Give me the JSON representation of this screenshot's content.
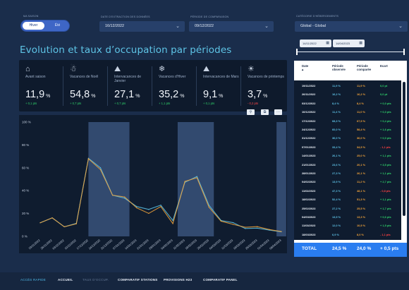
{
  "filters": {
    "season_label": "Ma saison",
    "season_options": [
      "Hiver",
      "Été"
    ],
    "date_label": "Date d'extraction des données",
    "date_value": "16/12/2022",
    "compare_label": "Période de comparaison",
    "compare_value": "09/12/2022",
    "category_label": "Catégorie d'hébergements",
    "category_value": "Global - Global"
  },
  "title": "Evolution et taux d’occupation par périodes",
  "date_range": {
    "start": "14/11/2022",
    "end": "14/04/2023"
  },
  "kpis": [
    {
      "icon": "⌂",
      "icon_name": "house-icon",
      "name": "Avant saison",
      "value": "11,9",
      "unit": "%",
      "delta": "+ 0,1 pts",
      "negative": false
    },
    {
      "icon": "☃",
      "icon_name": "christmas-tree-icon",
      "name": "Vacances de Noël",
      "value": "54,8",
      "unit": "%",
      "delta": "+ 0,7 pts",
      "negative": false
    },
    {
      "icon": "⛰",
      "icon_name": "mountain-icon",
      "name": "Intervacances de Janvier",
      "value": "27,1",
      "unit": "%",
      "delta": "+ 0,7 pts",
      "negative": false
    },
    {
      "icon": "❄",
      "icon_name": "snowflake-icon",
      "name": "Vacances d'Hiver",
      "value": "35,2",
      "unit": "%",
      "delta": "+ 1,1 pts",
      "negative": false
    },
    {
      "icon": "⛰",
      "icon_name": "mountain-icon",
      "name": "Intervacances de Mars",
      "value": "9,1",
      "unit": "%",
      "delta": "+ 0,1 pts",
      "negative": false
    },
    {
      "icon": "☀",
      "icon_name": "sun-icon",
      "name": "Vacances de printemps",
      "value": "3,7",
      "unit": "%",
      "delta": "- 0,2 pts",
      "negative": true
    }
  ],
  "table": {
    "headers": {
      "date": "Date",
      "observed": "Période observée",
      "compared": "Période comparée",
      "ecart": "Ecart"
    },
    "rows": [
      {
        "date": "19/11/2022",
        "obs": "11,9 %",
        "cmp": "11,9 %",
        "ecart": "0,0 pt",
        "neg": false
      },
      {
        "date": "26/11/2022",
        "obs": "16,2 %",
        "cmp": "16,2 %",
        "ecart": "0,0 pt",
        "neg": false
      },
      {
        "date": "03/12/2022",
        "obs": "8,4 %",
        "cmp": "8,4 %",
        "ecart": "+ 0,0 pts",
        "neg": false
      },
      {
        "date": "10/12/2022",
        "obs": "11,4 %",
        "cmp": "11,0 %",
        "ecart": "+ 0,3 pts",
        "neg": false
      },
      {
        "date": "17/12/2022",
        "obs": "68,3 %",
        "cmp": "67,9 %",
        "ecart": "+ 0,4 pts",
        "neg": false
      },
      {
        "date": "24/12/2022",
        "obs": "60,0 %",
        "cmp": "58,4 %",
        "ecart": "+ 1,6 pts",
        "neg": false
      },
      {
        "date": "31/12/2022",
        "obs": "36,0 %",
        "cmp": "36,0 %",
        "ecart": "+ 0,0 pts",
        "neg": false
      },
      {
        "date": "07/01/2023",
        "obs": "33,4 %",
        "cmp": "34,5 %",
        "ecart": "- 1,1 pts",
        "neg": true
      },
      {
        "date": "14/01/2023",
        "obs": "26,1 %",
        "cmp": "25,0 %",
        "ecart": "+ 1,1 pts",
        "neg": false
      },
      {
        "date": "21/01/2023",
        "obs": "23,6 %",
        "cmp": "20,1 %",
        "ecart": "+ 3,5 pts",
        "neg": false
      },
      {
        "date": "28/01/2023",
        "obs": "27,3 %",
        "cmp": "26,1 %",
        "ecart": "+ 1,1 pts",
        "neg": false
      },
      {
        "date": "04/02/2023",
        "obs": "13,9 %",
        "cmp": "11,2 %",
        "ecart": "+ 2,7 pts",
        "neg": false
      },
      {
        "date": "11/02/2023",
        "obs": "47,3 %",
        "cmp": "48,1 %",
        "ecart": "- 0,8 pts",
        "neg": true
      },
      {
        "date": "18/02/2023",
        "obs": "52,4 %",
        "cmp": "51,3 %",
        "ecart": "+ 1,1 pts",
        "neg": false
      },
      {
        "date": "25/02/2023",
        "obs": "27,2 %",
        "cmp": "25,5 %",
        "ecart": "+ 1,7 pts",
        "neg": false
      },
      {
        "date": "04/03/2023",
        "obs": "13,9 %",
        "cmp": "13,3 %",
        "ecart": "+ 0,6 pts",
        "neg": false
      },
      {
        "date": "11/03/2023",
        "obs": "12,0 %",
        "cmp": "10,5 %",
        "ecart": "+ 1,5 pts",
        "neg": false
      },
      {
        "date": "18/03/2023",
        "obs": "6,9 %",
        "cmp": "8,0 %",
        "ecart": "- 1,1 pts",
        "neg": true
      }
    ],
    "total": {
      "label": "TOTAL",
      "obs": "24,5 %",
      "cmp": "24,0 %",
      "ecart": "+ 0,5 pts"
    }
  },
  "chart_data": {
    "type": "line",
    "x": [
      "19/11/2022",
      "26/11/2022",
      "03/12/2022",
      "10/12/2022",
      "17/12/2022",
      "24/12/2022",
      "31/12/2022",
      "07/01/2023",
      "14/01/2023",
      "21/01/2023",
      "28/01/2023",
      "04/02/2023",
      "11/02/2023",
      "18/02/2023",
      "25/02/2023",
      "04/03/2023",
      "11/03/2023",
      "18/03/2023",
      "25/03/2023",
      "01/04/2023",
      "08/04/2023"
    ],
    "series": [
      {
        "color": "#5ec4e6",
        "values": [
          11.9,
          16.2,
          8.4,
          11.4,
          68.3,
          60.0,
          36.0,
          33.4,
          26.1,
          23.6,
          27.3,
          13.9,
          47.3,
          52.4,
          27.2,
          13.9,
          12.0,
          6.9,
          7.2,
          5.5,
          4.0
        ]
      },
      {
        "color": "#f2a33a",
        "values": [
          11.9,
          16.2,
          8.4,
          11.0,
          67.9,
          58.4,
          36.0,
          34.5,
          25.0,
          20.1,
          26.1,
          11.2,
          48.1,
          51.3,
          25.5,
          13.3,
          10.5,
          8.0,
          8.5,
          6.0,
          4.2
        ]
      }
    ],
    "yticks": [
      "0 %",
      "20 %",
      "40 %",
      "60 %",
      "80 %",
      "100 %"
    ],
    "ylim": [
      0,
      100
    ],
    "shaded_periods": [
      [
        4,
        7.4
      ],
      [
        11.4,
        14.4
      ],
      [
        19.6,
        20.4
      ]
    ]
  },
  "bottom_nav": {
    "quick": "ACCÈS RAPIDE",
    "items": [
      "ACCUEIL",
      "TAUX D'OCCUP.",
      "COMPARATIF STATIONS",
      "PROVISIONS H23",
      "COMPARATIF PANEL"
    ]
  }
}
